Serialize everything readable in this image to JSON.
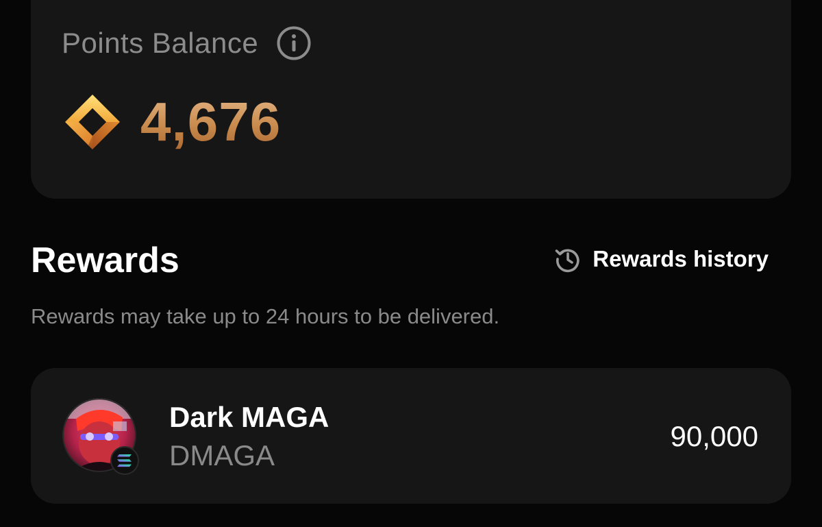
{
  "balance": {
    "label": "Points Balance",
    "value": "4,676",
    "info_icon": "info-icon",
    "points_icon": "points-diamond-icon"
  },
  "rewards": {
    "title": "Rewards",
    "history_label": "Rewards history",
    "history_icon": "history-icon",
    "note": "Rewards may take up to 24 hours to be delivered.",
    "items": [
      {
        "name": "Dark MAGA",
        "symbol": "DMAGA",
        "amount": "90,000",
        "avatar_icon": "token-avatar",
        "chain_icon": "solana-badge-icon"
      }
    ]
  },
  "colors": {
    "background": "#060606",
    "card": "#161616",
    "muted_text": "#8a8a8a",
    "points_gold": "#d69a5c"
  }
}
